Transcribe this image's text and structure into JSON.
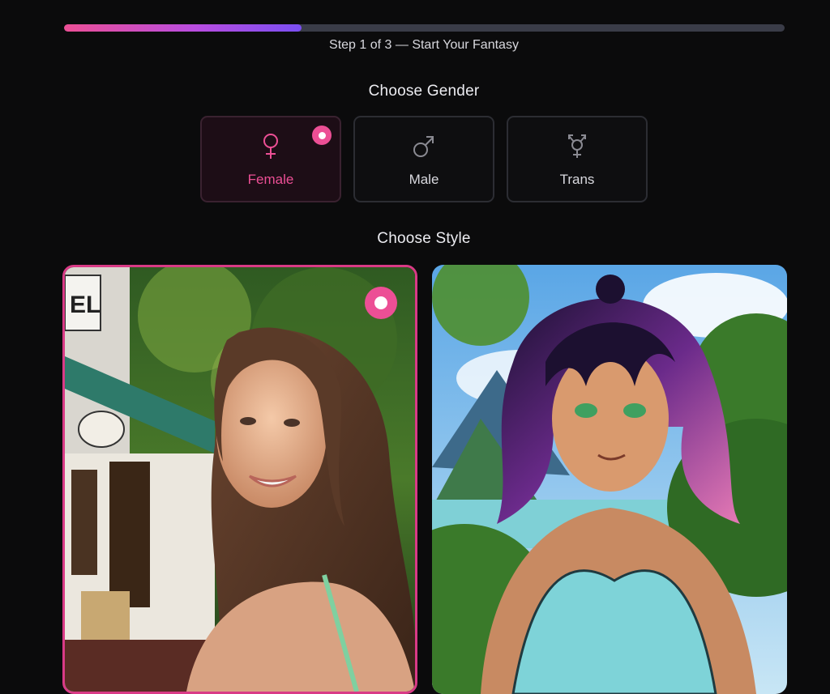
{
  "progress": {
    "percent": 33,
    "step_text": "Step 1 of 3 — Start Your Fantasy"
  },
  "gender_section": {
    "title": "Choose Gender",
    "options": [
      {
        "label": "Female",
        "icon": "female-symbol-icon",
        "selected": true
      },
      {
        "label": "Male",
        "icon": "male-symbol-icon",
        "selected": false
      },
      {
        "label": "Trans",
        "icon": "transgender-symbol-icon",
        "selected": false
      }
    ]
  },
  "style_section": {
    "title": "Choose Style",
    "options": [
      {
        "image": "realistic-woman-photo",
        "selected": true
      },
      {
        "image": "anime-woman-illustration",
        "selected": false
      }
    ]
  },
  "colors": {
    "accent": "#ec4f95",
    "background": "#0b0b0c",
    "progress_track": "#3a3c48"
  }
}
